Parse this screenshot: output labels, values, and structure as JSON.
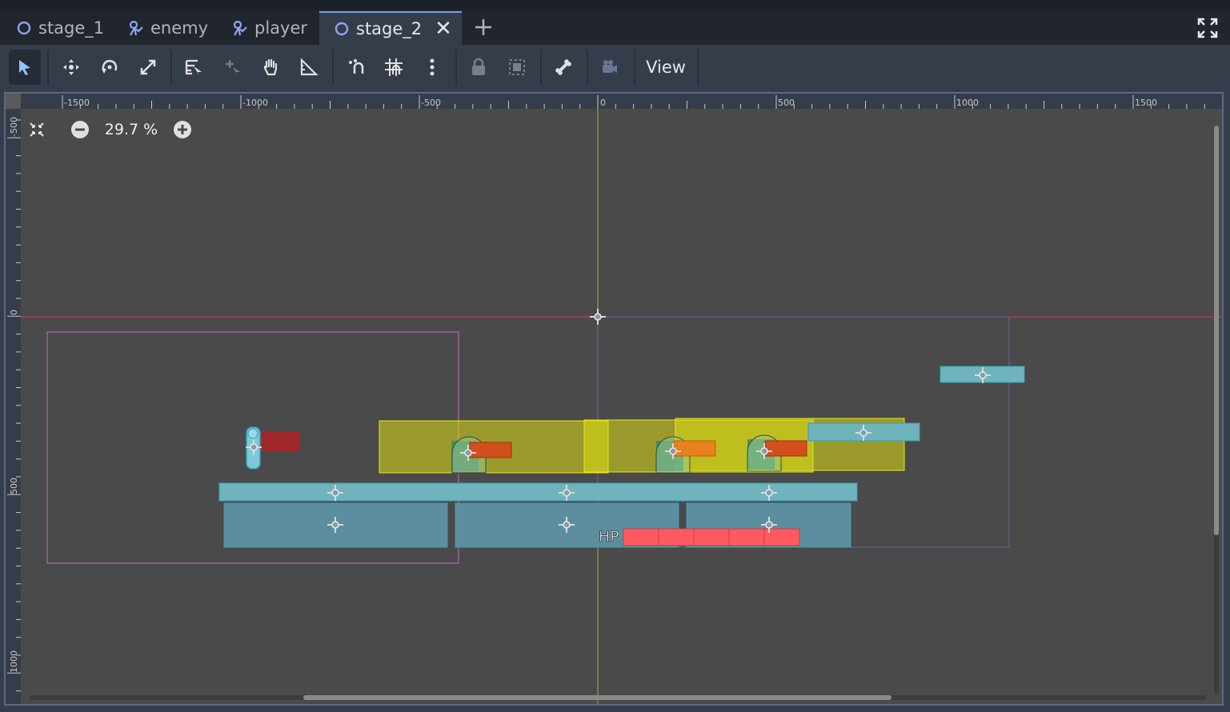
{
  "tabs": [
    {
      "label": "stage_1",
      "icon": "node2d-icon"
    },
    {
      "label": "enemy",
      "icon": "character-body-icon"
    },
    {
      "label": "player",
      "icon": "character-body-icon"
    },
    {
      "label": "stage_2",
      "icon": "node2d-icon",
      "active": true
    }
  ],
  "toolbar": {
    "tools": [
      "select-mode-icon",
      "move-mode-icon",
      "rotate-mode-icon",
      "scale-mode-icon",
      "list-select-icon",
      "pivot-mode-icon",
      "pan-mode-icon",
      "ruler-mode-icon",
      "smart-snap-icon",
      "grid-snap-icon",
      "more-options-icon",
      "lock-icon",
      "group-icon",
      "bone-icon",
      "camera-override-icon"
    ],
    "view_label": "View"
  },
  "zoom": {
    "label": "29.7 %"
  },
  "rulers": {
    "horizontal_labels": [
      "-1500",
      "-1000",
      "-500",
      "0",
      "500",
      "1000",
      "1500"
    ],
    "vertical_labels": [
      "-500",
      "0",
      "500",
      "1000"
    ]
  },
  "scene": {
    "hp_label": "HP"
  },
  "colors": {
    "accent": "#6ea3e8",
    "viewport_bg": "#4a4a4a",
    "collision_shape": "#5c9ea8",
    "area_yellow": "#e6e61e",
    "hp_red": "#ff5a5f",
    "x_axis": "#d2414b",
    "y_axis": "#8fbf3c"
  }
}
